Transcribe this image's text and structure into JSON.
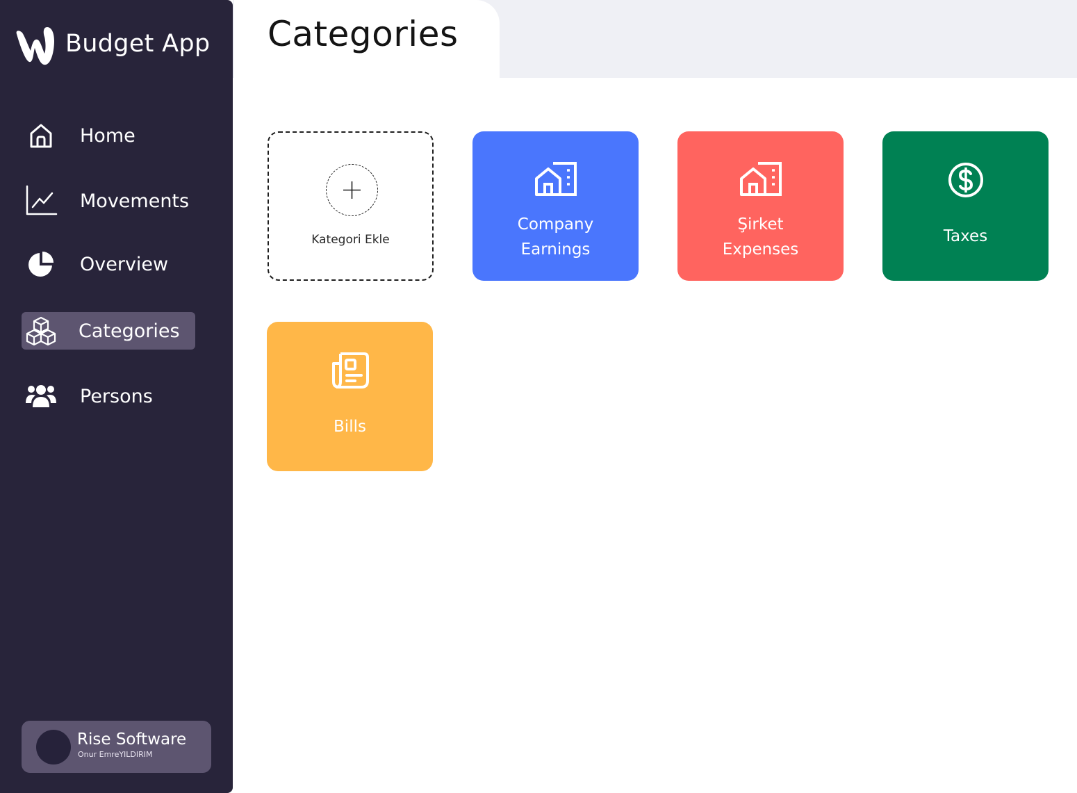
{
  "app": {
    "name": "Budget App"
  },
  "sidebar": {
    "items": [
      {
        "label": "Home",
        "icon": "home-icon",
        "active": false
      },
      {
        "label": "Movements",
        "icon": "line-chart-icon",
        "active": false
      },
      {
        "label": "Overview",
        "icon": "pie-chart-icon",
        "active": false
      },
      {
        "label": "Categories",
        "icon": "boxes-icon",
        "active": true
      },
      {
        "label": "Persons",
        "icon": "users-icon",
        "active": false
      }
    ],
    "profile": {
      "name": "Rise Software",
      "subtitle": "Onur EmreYILDIRIM"
    }
  },
  "header": {
    "title": "Categories"
  },
  "add_category": {
    "label": "Kategori Ekle",
    "icon": "plus-icon"
  },
  "categories": [
    {
      "line1": "Company",
      "line2": "Earnings",
      "icon": "building-icon",
      "color": "#4a76fd"
    },
    {
      "line1": "Şirket",
      "line2": "Expenses",
      "icon": "building-icon",
      "color": "#ff645f"
    },
    {
      "line1": "Taxes",
      "icon": "dollar-circle-icon",
      "color": "#008153"
    },
    {
      "line1": "Bills",
      "icon": "receipt-icon",
      "color": "#ffb748"
    }
  ],
  "colors": {
    "sidebar_bg": "#28243a",
    "active_item_bg": "#5d5570",
    "topbar_bg": "#eff0f5"
  }
}
